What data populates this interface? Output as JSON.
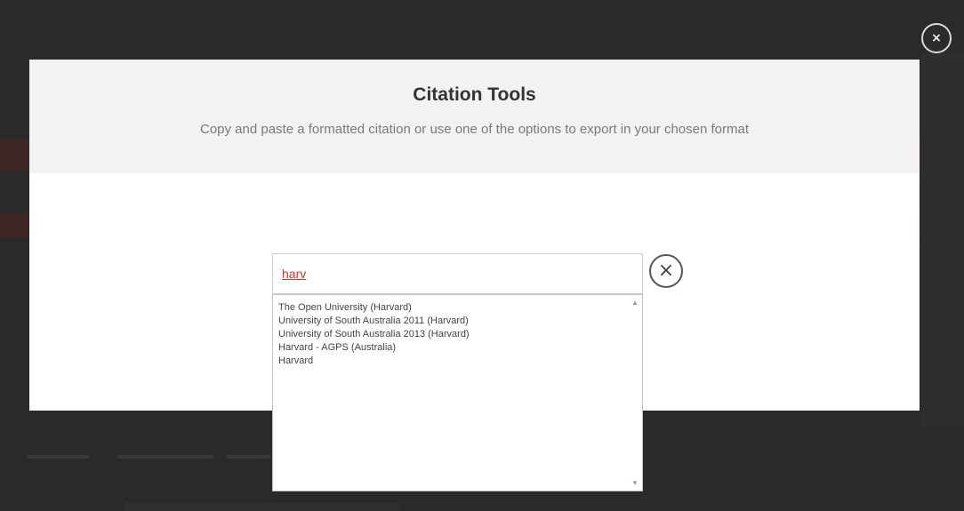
{
  "modal": {
    "title": "Citation Tools",
    "subtitle": "Copy and paste a formatted citation or use one of the options to export in your chosen format"
  },
  "close_button": {
    "label": "×"
  },
  "style_search": {
    "value": "harv",
    "clear_label": "×"
  },
  "results": {
    "items": [
      "The Open University (Harvard)",
      "University of South Australia 2011 (Harvard)",
      "University of South Australia 2013 (Harvard)",
      "Harvard - AGPS (Australia)",
      "Harvard"
    ],
    "scroll_up_icon": "▲",
    "scroll_down_icon": "▼"
  }
}
